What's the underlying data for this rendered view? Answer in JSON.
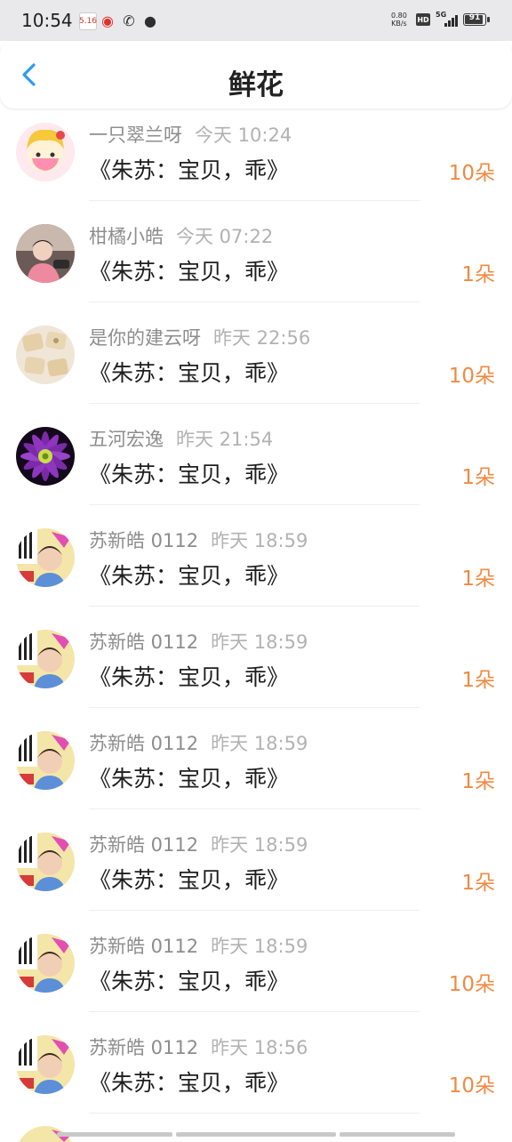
{
  "status_bar": {
    "time": "10:54",
    "notifications": [
      "calendar-icon",
      "weibo-icon",
      "missed-call-icon",
      "wechat-icon"
    ],
    "net_speed_value": "0.80",
    "net_speed_unit": "KB/s",
    "hd_label": "HD",
    "network_label": "5G",
    "battery": "91"
  },
  "header": {
    "title": "鲜花",
    "back_icon": "chevron-left-icon",
    "accent_color": "#2f9cf0"
  },
  "list": {
    "count_color": "#ef8a42",
    "items": [
      {
        "sender": "一只翠兰呀",
        "time": "今天 10:24",
        "gift": "《朱苏：宝贝，乖》",
        "count": "10朵"
      },
      {
        "sender": "柑橘小皓",
        "time": "今天 07:22",
        "gift": "《朱苏：宝贝，乖》",
        "count": "1朵"
      },
      {
        "sender": "是你的建云呀",
        "time": "昨天 22:56",
        "gift": "《朱苏：宝贝，乖》",
        "count": "10朵"
      },
      {
        "sender": "五河宏逸",
        "time": "昨天 21:54",
        "gift": "《朱苏：宝贝，乖》",
        "count": "1朵"
      },
      {
        "sender": "苏新皓 0112",
        "time": "昨天 18:59",
        "gift": "《朱苏：宝贝，乖》",
        "count": "1朵"
      },
      {
        "sender": "苏新皓 0112",
        "time": "昨天 18:59",
        "gift": "《朱苏：宝贝，乖》",
        "count": "1朵"
      },
      {
        "sender": "苏新皓 0112",
        "time": "昨天 18:59",
        "gift": "《朱苏：宝贝，乖》",
        "count": "1朵"
      },
      {
        "sender": "苏新皓 0112",
        "time": "昨天 18:59",
        "gift": "《朱苏：宝贝，乖》",
        "count": "1朵"
      },
      {
        "sender": "苏新皓 0112",
        "time": "昨天 18:59",
        "gift": "《朱苏：宝贝，乖》",
        "count": "10朵"
      },
      {
        "sender": "苏新皓 0112",
        "time": "昨天 18:56",
        "gift": "《朱苏：宝贝，乖》",
        "count": "10朵"
      }
    ]
  }
}
